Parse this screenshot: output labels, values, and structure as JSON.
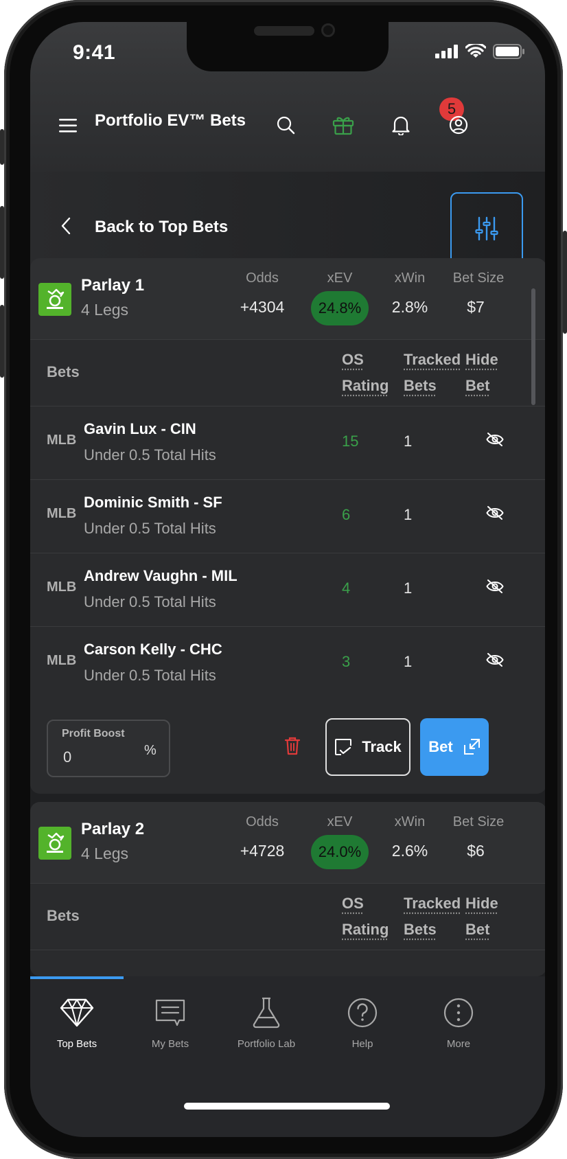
{
  "status_bar": {
    "time": "9:41"
  },
  "header": {
    "title": "Portfolio EV™ Bets",
    "notification_count": "5"
  },
  "subheader": {
    "back_label": "Back to Top Bets"
  },
  "stat_labels": {
    "odds": "Odds",
    "xev": "xEV",
    "xwin": "xWin",
    "bet_size": "Bet Size"
  },
  "bets_table_header": {
    "bets": "Bets",
    "os_line1": "OS",
    "os_line2": "Rating",
    "tracked_line1": "Tracked",
    "tracked_line2": "Bets",
    "hide_line1": "Hide",
    "hide_line2": "Bet"
  },
  "parlays": [
    {
      "title": "Parlay 1",
      "legs": "4 Legs",
      "odds": "+4304",
      "xev": "24.8%",
      "xwin": "2.8%",
      "bet_size": "$7",
      "bets": [
        {
          "league": "MLB",
          "player": "Gavin Lux - CIN",
          "market": "Under 0.5 Total Hits",
          "rating": "15",
          "tracked": "1"
        },
        {
          "league": "MLB",
          "player": "Dominic Smith - SF",
          "market": "Under 0.5 Total Hits",
          "rating": "6",
          "tracked": "1"
        },
        {
          "league": "MLB",
          "player": "Andrew Vaughn - MIL",
          "market": "Under 0.5 Total Hits",
          "rating": "4",
          "tracked": "1"
        },
        {
          "league": "MLB",
          "player": "Carson Kelly - CHC",
          "market": "Under 0.5 Total Hits",
          "rating": "3",
          "tracked": "1"
        }
      ]
    },
    {
      "title": "Parlay 2",
      "legs": "4 Legs",
      "odds": "+4728",
      "xev": "24.0%",
      "xwin": "2.6%",
      "bet_size": "$6"
    }
  ],
  "parlay_footer": {
    "profit_boost_label": "Profit Boost",
    "profit_boost_value": "0",
    "profit_boost_unit": "%",
    "track_label": "Track",
    "bet_label": "Bet"
  },
  "tabs": [
    {
      "label": "Top Bets",
      "icon": "diamond-icon",
      "active": true
    },
    {
      "label": "My Bets",
      "icon": "receipt-icon",
      "active": false
    },
    {
      "label": "Portfolio Lab",
      "icon": "flask-icon",
      "active": false
    },
    {
      "label": "Help",
      "icon": "help-icon",
      "active": false
    },
    {
      "label": "More",
      "icon": "more-icon",
      "active": false
    }
  ],
  "colors": {
    "accent": "#3b9af0",
    "positive": "#3aa04a",
    "xev_pill": "#1f7a33",
    "danger": "#e03a3a",
    "sportsbook": "#53b32b"
  }
}
